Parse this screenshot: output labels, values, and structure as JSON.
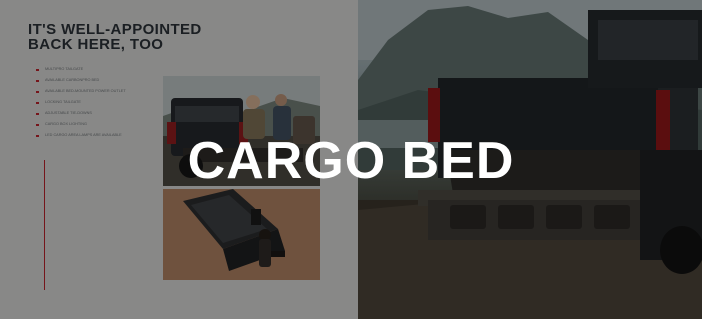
{
  "overlay": {
    "title": "CARGO BED"
  },
  "left_page": {
    "heading": "IT'S WELL-APPOINTED BACK HERE, TOO",
    "bullets": [
      "MULTIPRO TAILGATE",
      "AVAILABLE CARBONPRO BED",
      "AVAILABLE BED-MOUNTED POWER OUTLET",
      "LOCKING TAILGATE",
      "ADJUSTABLE TIE-DOWNS",
      "CARGO BOX LIGHTING",
      "LED CARGO AREA LAMPS ARE AVAILABLE"
    ],
    "paragraph": "",
    "footnote": ""
  },
  "images": {
    "left_top": "pickup-tailgate-photo",
    "left_bottom": "cargo-bed-detail-photo",
    "right_main": "pickup-multipro-tailgate-photo"
  }
}
